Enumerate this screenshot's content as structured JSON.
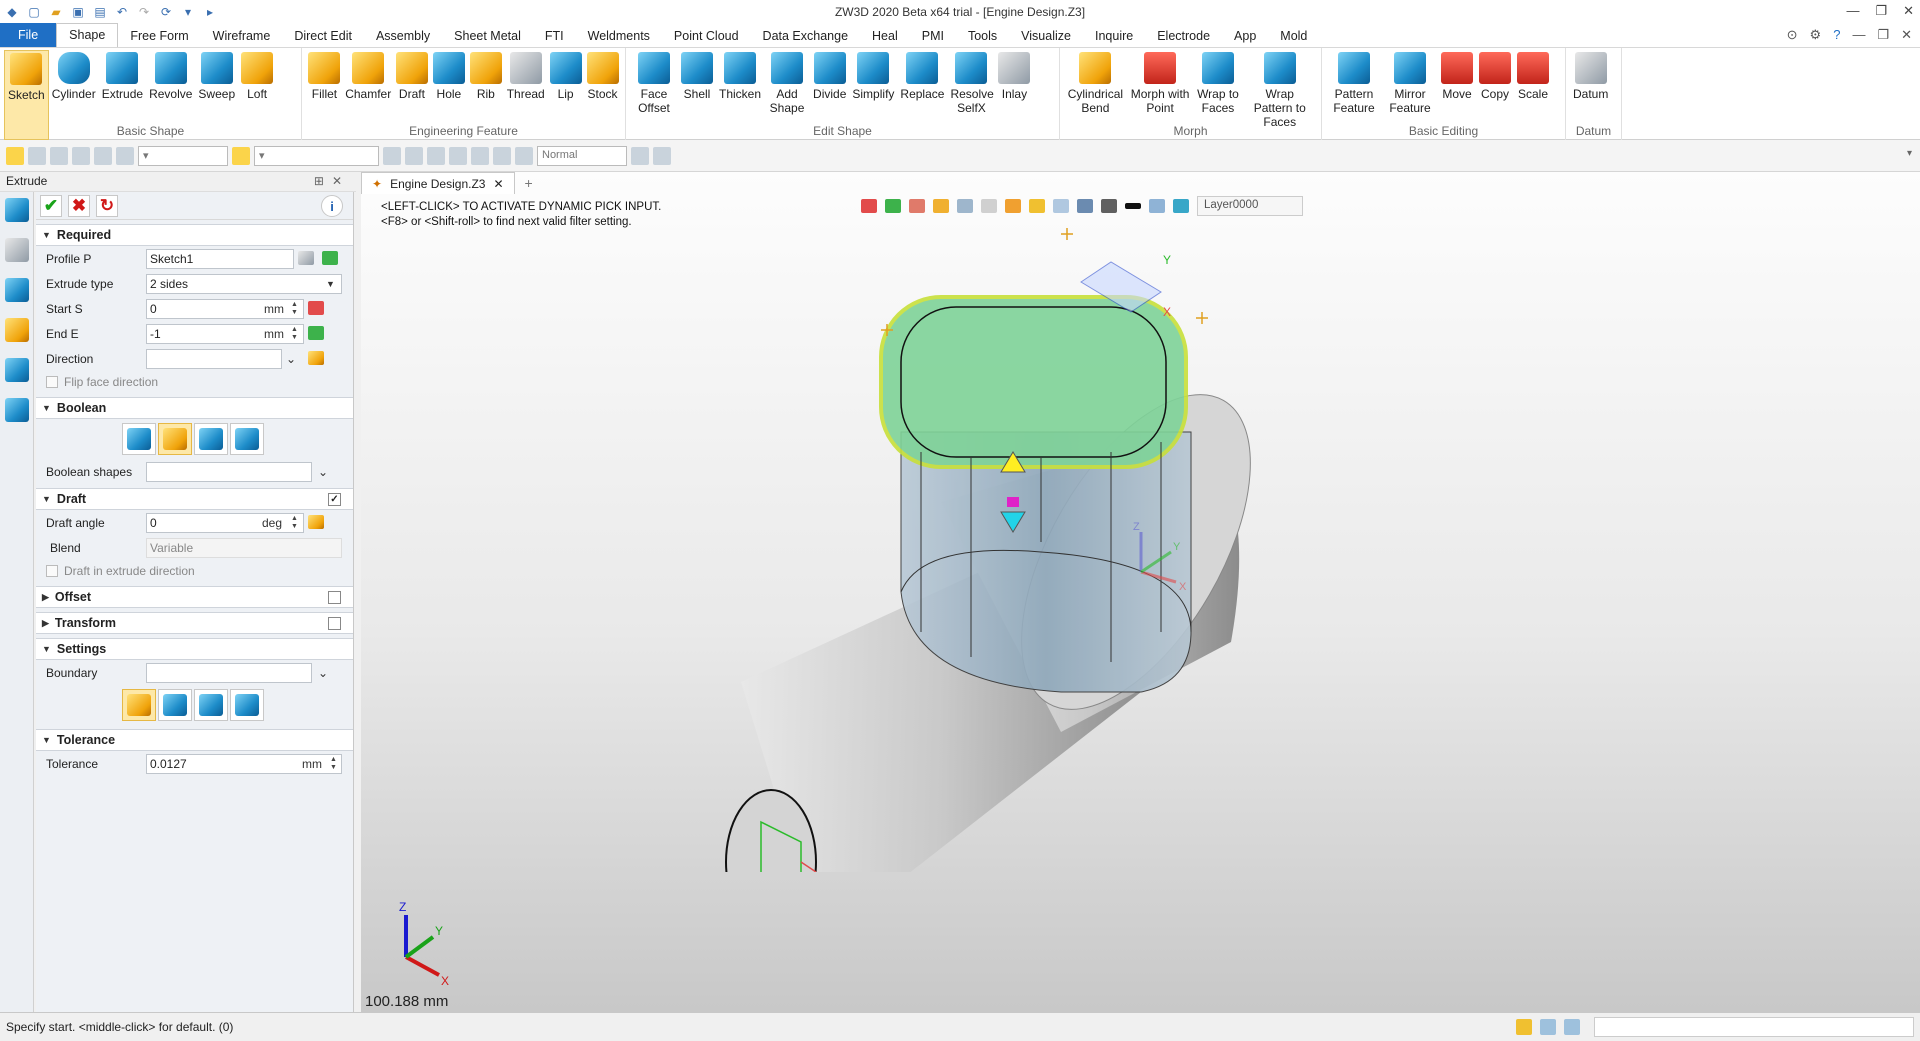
{
  "window": {
    "title": "ZW3D 2020 Beta x64 trial - [Engine Design.Z3]"
  },
  "menu": {
    "file": "File",
    "items": [
      "Shape",
      "Free Form",
      "Wireframe",
      "Direct Edit",
      "Assembly",
      "Sheet Metal",
      "FTI",
      "Weldments",
      "Point Cloud",
      "Data Exchange",
      "Heal",
      "PMI",
      "Tools",
      "Visualize",
      "Inquire",
      "Electrode",
      "App",
      "Mold"
    ],
    "active": "Shape"
  },
  "ribbon": {
    "basic_shape": {
      "label": "Basic Shape",
      "buttons": [
        "Sketch",
        "Cylinder",
        "Extrude",
        "Revolve",
        "Sweep",
        "Loft"
      ]
    },
    "engineering": {
      "label": "Engineering Feature",
      "buttons": [
        "Fillet",
        "Chamfer",
        "Draft",
        "Hole",
        "Rib",
        "Thread",
        "Lip",
        "Stock"
      ]
    },
    "edit_shape": {
      "label": "Edit Shape",
      "buttons": [
        "Face Offset",
        "Shell",
        "Thicken",
        "Add Shape",
        "Divide",
        "Simplify",
        "Replace",
        "Resolve SelfX",
        "Inlay"
      ]
    },
    "morph": {
      "label": "Morph",
      "buttons": [
        "Cylindrical Bend",
        "Morph with Point",
        "Wrap to Faces",
        "Wrap Pattern to Faces"
      ]
    },
    "basic_editing": {
      "label": "Basic Editing",
      "buttons": [
        "Pattern Feature",
        "Mirror Feature",
        "Move",
        "Copy",
        "Scale"
      ]
    },
    "datum": {
      "label": "Datum",
      "buttons": [
        "Datum"
      ]
    }
  },
  "toolbar2": {
    "render_mode": "Normal"
  },
  "panel": {
    "title": "Extrude",
    "required": {
      "header": "Required",
      "profile_label": "Profile P",
      "profile_value": "Sketch1",
      "type_label": "Extrude type",
      "type_value": "2 sides",
      "start_label": "Start S",
      "start_value": "0",
      "start_unit": "mm",
      "end_label": "End E",
      "end_value": "-1",
      "end_unit": "mm",
      "direction_label": "Direction",
      "direction_value": "",
      "flip_label": "Flip face direction"
    },
    "boolean": {
      "header": "Boolean",
      "shapes_label": "Boolean shapes",
      "shapes_value": ""
    },
    "draft": {
      "header": "Draft",
      "checked": "✓",
      "angle_label": "Draft angle",
      "angle_value": "0",
      "angle_unit": "deg",
      "blend_label": "Blend",
      "blend_value": "Variable",
      "dir_label": "Draft in extrude direction"
    },
    "offset": {
      "header": "Offset"
    },
    "transform": {
      "header": "Transform"
    },
    "settings": {
      "header": "Settings",
      "boundary_label": "Boundary",
      "boundary_value": ""
    },
    "tolerance": {
      "header": "Tolerance",
      "label": "Tolerance",
      "value": "0.0127",
      "unit": "mm"
    }
  },
  "viewport": {
    "tab": "Engine Design.Z3",
    "hint1": "<LEFT-CLICK> TO ACTIVATE DYNAMIC PICK INPUT.",
    "hint2": "<F8> or <Shift-roll> to find next valid filter setting.",
    "layer": "Layer0000",
    "measurement": "100.188 mm",
    "axis_x": "X",
    "axis_y": "Y",
    "axis_z": "Z"
  },
  "status": {
    "text": "Specify start.  <middle-click> for default. (0)"
  }
}
